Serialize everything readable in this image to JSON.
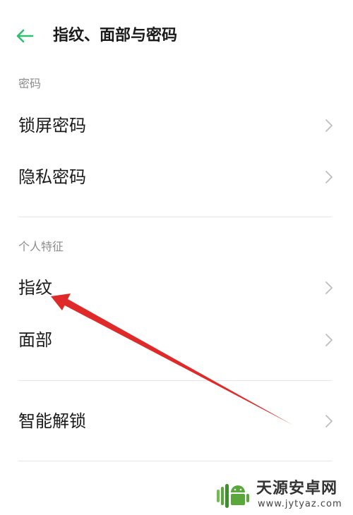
{
  "header": {
    "back_icon": "arrow-left-icon",
    "title": "指纹、面部与密码"
  },
  "accent_color": "#2fbf71",
  "sections": {
    "password": {
      "header": "密码",
      "items": [
        {
          "label": "锁屏密码",
          "icon": "chevron-right-icon"
        },
        {
          "label": "隐私密码",
          "icon": "chevron-right-icon"
        }
      ]
    },
    "biometrics": {
      "header": "个人特征",
      "items": [
        {
          "label": "指纹",
          "icon": "chevron-right-icon"
        },
        {
          "label": "面部",
          "icon": "chevron-right-icon"
        }
      ]
    },
    "smart": {
      "items": [
        {
          "label": "智能解锁",
          "icon": "chevron-right-icon"
        }
      ]
    }
  },
  "annotation": {
    "color": "#e02a2a",
    "points_to": "指纹"
  },
  "watermark": {
    "name": "天源安卓网",
    "url": "www.jytyaz.com"
  }
}
